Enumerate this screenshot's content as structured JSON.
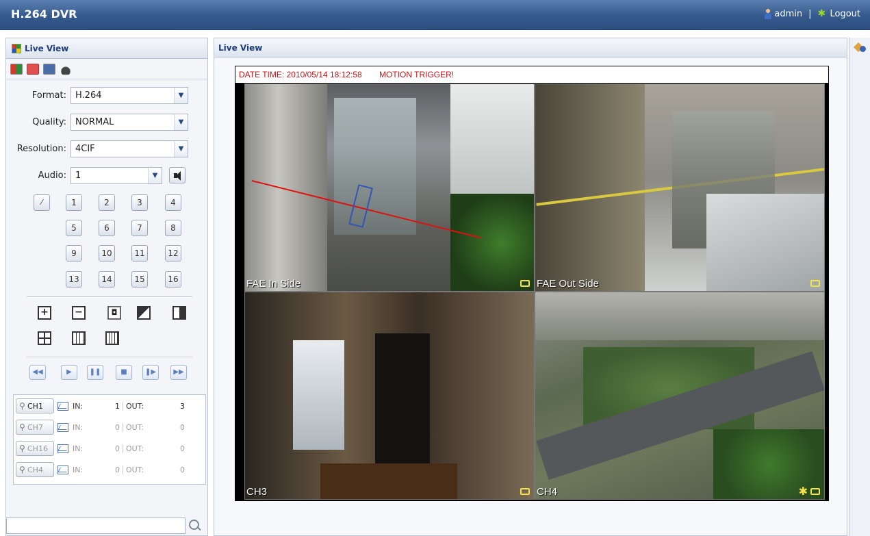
{
  "app": {
    "title": "H.264 DVR",
    "user": "admin",
    "separator": "|",
    "logout": "Logout"
  },
  "left_panel": {
    "title": "Live View",
    "form": {
      "format_label": "Format:",
      "format_value": "H.264",
      "quality_label": "Quality:",
      "quality_value": "NORMAL",
      "resolution_label": "Resolution:",
      "resolution_value": "4CIF",
      "audio_label": "Audio:",
      "audio_value": "1"
    },
    "channels": [
      "1",
      "2",
      "3",
      "4",
      "5",
      "6",
      "7",
      "8",
      "9",
      "10",
      "11",
      "12",
      "13",
      "14",
      "15",
      "16"
    ],
    "alarms": [
      {
        "channel": "CH1",
        "in_label": "IN:",
        "in_value": "1",
        "out_label": "OUT:",
        "out_value": "3"
      },
      {
        "channel": "CH7",
        "in_label": "IN:",
        "in_value": "0",
        "out_label": "OUT:",
        "out_value": "0"
      },
      {
        "channel": "CH16",
        "in_label": "IN:",
        "in_value": "0",
        "out_label": "OUT:",
        "out_value": "0"
      },
      {
        "channel": "CH4",
        "in_label": "IN:",
        "in_value": "0",
        "out_label": "OUT:",
        "out_value": "0"
      }
    ],
    "search_placeholder": ""
  },
  "main": {
    "title": "Live View",
    "info_datetime": "DATE TIME: 2010/05/14 18:12:58",
    "info_trigger": "MOTION TRIGGER!",
    "cameras": [
      {
        "label": "FAE In Side"
      },
      {
        "label": "FAE Out Side"
      },
      {
        "label": "CH3"
      },
      {
        "label": "CH4"
      }
    ]
  },
  "icons": {
    "user": "person-icon",
    "logout": "running-man-icon",
    "search": "magnifier-icon",
    "settings": "wrench-icon",
    "record": "camera-record-icon",
    "motion": "motion-icon"
  },
  "colors": {
    "topbar": "#35598c",
    "info_text": "#c0151b",
    "record_indicator": "#f2e34a"
  }
}
